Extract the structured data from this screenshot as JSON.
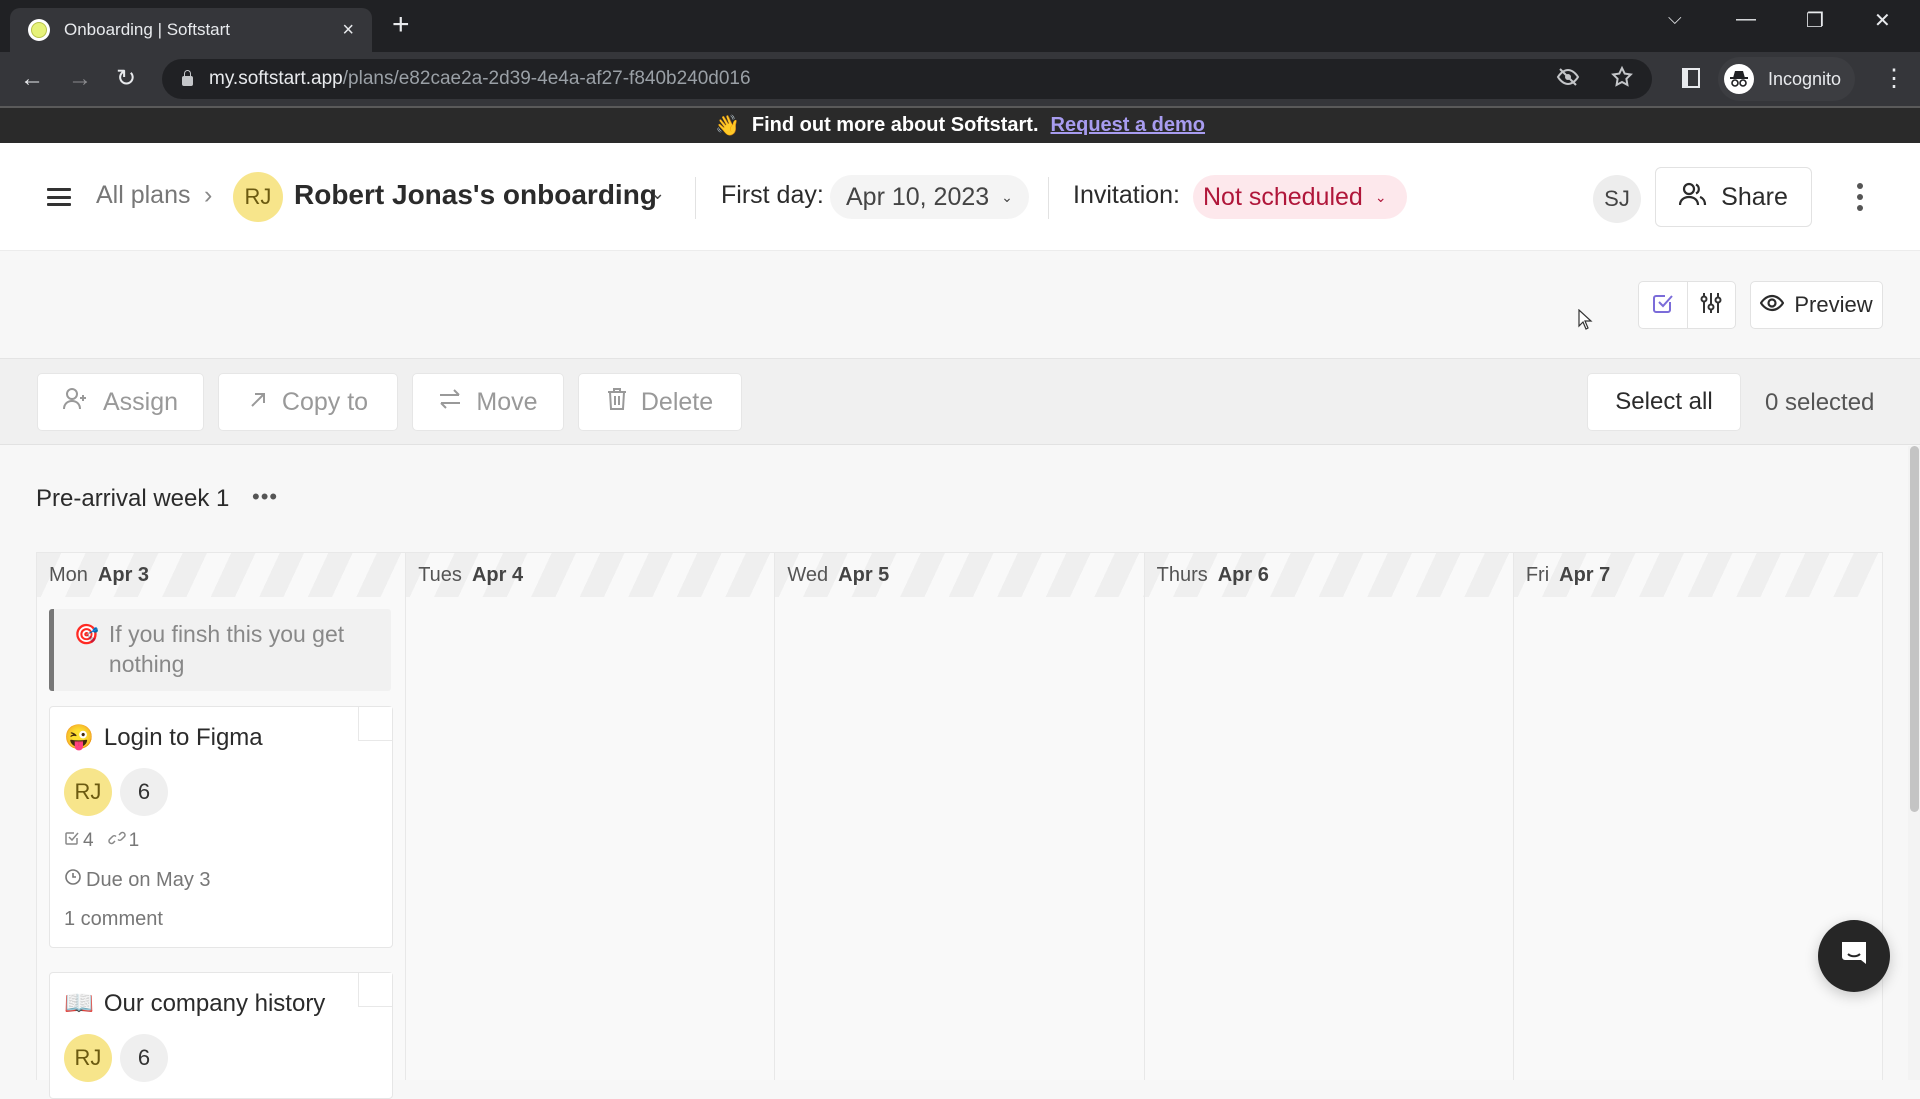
{
  "browser": {
    "tab_title": "Onboarding | Softstart",
    "tab_close_icon": "×",
    "new_tab_icon": "+",
    "url_host": "my.softstart.app",
    "url_path": "/plans/e82cae2a-2d39-4e4a-af27-f840b240d016",
    "profile_label": "Incognito",
    "window_controls": {
      "dropdown": "⌵",
      "minimize": "—",
      "restore": "❐",
      "close": "✕"
    },
    "nav": {
      "back": "←",
      "forward": "→",
      "reload": "↻"
    }
  },
  "banner": {
    "emoji": "👋",
    "text": "Find out more about Softstart.",
    "link": "Request a demo"
  },
  "header": {
    "breadcrumb_root": "All plans",
    "breadcrumb_sep": "›",
    "plan_avatar": "RJ",
    "plan_title": "Robert Jonas's onboarding",
    "first_day_label": "First day:",
    "first_day_value": "Apr 10, 2023",
    "invitation_label": "Invitation:",
    "invitation_value": "Not scheduled",
    "user_avatar": "SJ",
    "share_label": "Share",
    "chevron": "⌄"
  },
  "subbar": {
    "preview_label": "Preview"
  },
  "actions": {
    "assign": "Assign",
    "copy_to": "Copy to",
    "move": "Move",
    "delete": "Delete",
    "select_all": "Select all",
    "selected_count": "0 selected"
  },
  "section": {
    "title": "Pre-arrival week 1",
    "more": "•••"
  },
  "days": [
    {
      "name": "Mon",
      "date": "Apr 3"
    },
    {
      "name": "Tues",
      "date": "Apr 4"
    },
    {
      "name": "Wed",
      "date": "Apr 5"
    },
    {
      "name": "Thurs",
      "date": "Apr 6"
    },
    {
      "name": "Fri",
      "date": "Apr 7"
    }
  ],
  "note": {
    "emoji": "🎯",
    "text": "If you finsh this you get nothing"
  },
  "tasks": [
    {
      "emoji": "😜",
      "title": "Login to Figma",
      "assignee": "RJ",
      "count": "6",
      "checklist": "4",
      "links": "1",
      "due": "Due on May 3",
      "comments": "1 comment"
    },
    {
      "emoji": "📖",
      "title": "Our company history",
      "assignee": "RJ",
      "count": "6"
    }
  ],
  "colors": {
    "accent": "#7b6cd9",
    "invitation_text": "#b0163a",
    "invitation_bg": "#fde8ec",
    "avatar_bg": "#f7e58b",
    "banner_link": "#a89cf0"
  }
}
